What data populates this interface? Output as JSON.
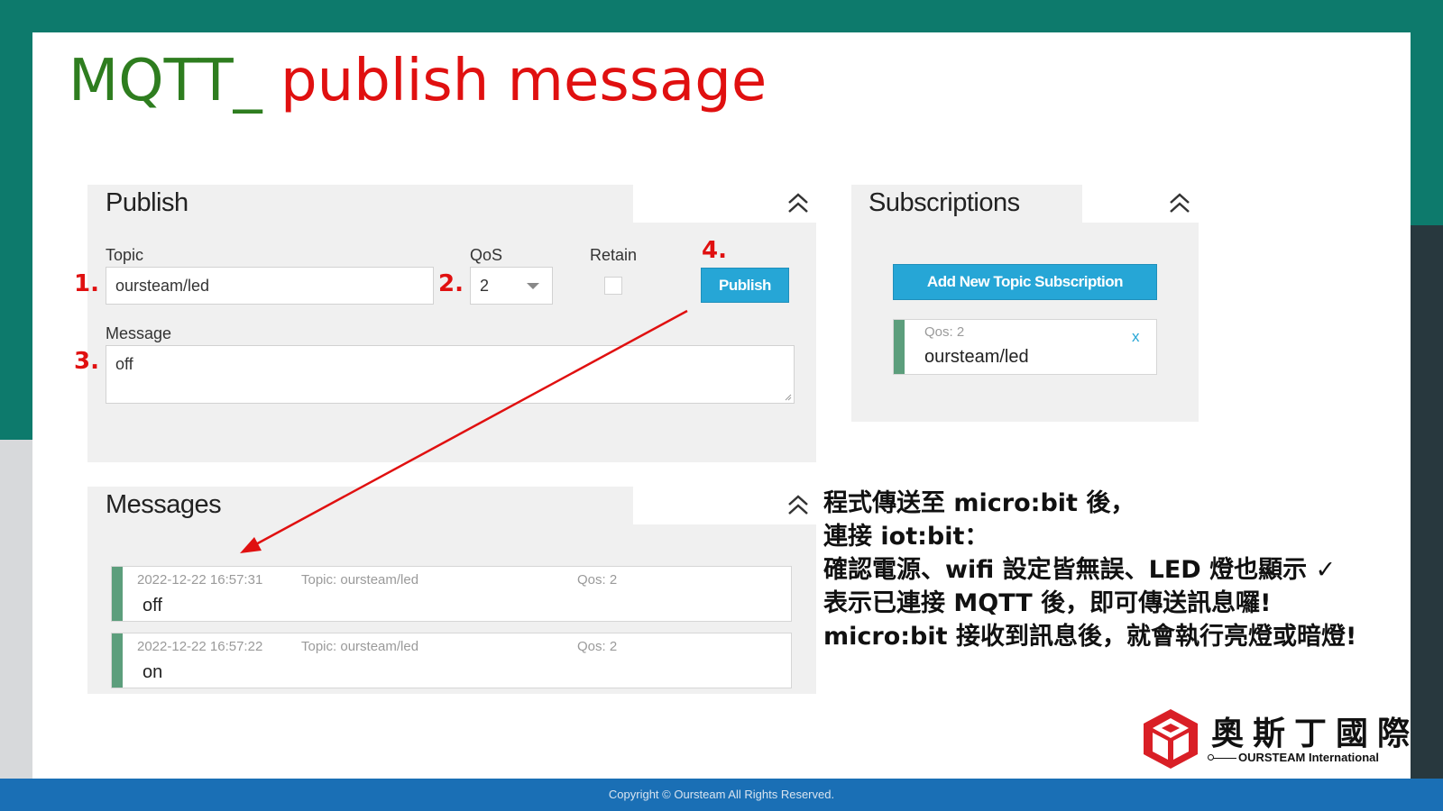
{
  "slide": {
    "title_part1": "MQTT_",
    "title_part2": "publish message",
    "footer": "Copyright © Oursteam All Rights Reserved."
  },
  "publish": {
    "title": "Publish",
    "topic_label": "Topic",
    "topic_value": "oursteam/led",
    "qos_label": "QoS",
    "qos_value": "2",
    "retain_label": "Retain",
    "retain_checked": false,
    "publish_button": "Publish",
    "message_label": "Message",
    "message_value": "off"
  },
  "steps": [
    "1.",
    "2.",
    "3.",
    "4."
  ],
  "subscriptions": {
    "title": "Subscriptions",
    "add_button": "Add New Topic Subscription",
    "items": [
      {
        "qos": "Qos: 2",
        "topic": "oursteam/led",
        "remove": "x"
      }
    ]
  },
  "messages": {
    "title": "Messages",
    "items": [
      {
        "time": "2022-12-22 16:57:31",
        "topic": "Topic: oursteam/led",
        "qos": "Qos: 2",
        "payload": "off"
      },
      {
        "time": "2022-12-22 16:57:22",
        "topic": "Topic: oursteam/led",
        "qos": "Qos: 2",
        "payload": "on"
      }
    ]
  },
  "description": [
    "程式傳送至 micro:bit 後，",
    "連接 iot:bit：",
    "確認電源、wifi 設定皆無誤、LED 燈也顯示 ✓",
    "表示已連接 MQTT 後，即可傳送訊息囉!",
    "micro:bit 接收到訊息後，就會執行亮燈或暗燈!"
  ],
  "logo": {
    "name_cn": "奧斯丁國際",
    "name_en": "OURSTEAM International"
  },
  "colors": {
    "accent_blue": "#26a6d6",
    "step_red": "#e01010",
    "title_green": "#2e7d1f",
    "message_bar": "#5c9e7c"
  }
}
